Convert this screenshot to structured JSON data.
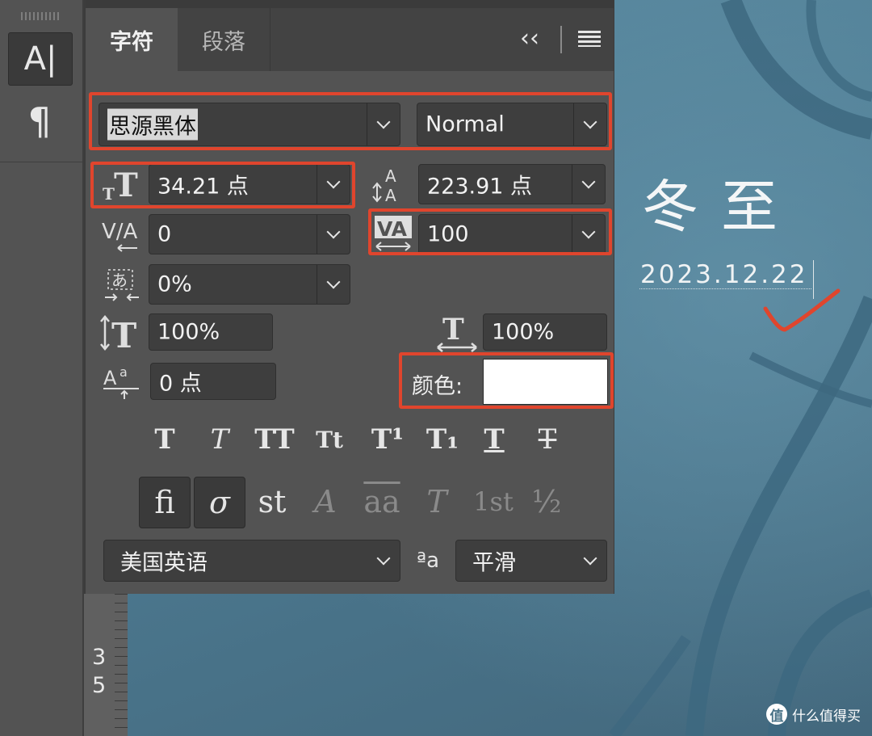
{
  "canvas": {
    "title": "冬至",
    "date": "2023.12.22",
    "watermark": "什么值得买",
    "watermark_icon": "值"
  },
  "toolbar": {
    "text_tool_icon": "A|",
    "paragraph_tool_icon": "¶"
  },
  "ruler": {
    "digits": [
      "3",
      "5"
    ]
  },
  "panel": {
    "tabs": [
      "字符",
      "段落"
    ],
    "collapse_icon": "‹‹",
    "menu_icon": "menu-icon",
    "font_family": "思源黑体",
    "font_style": "Normal",
    "font_size": "34.21 点",
    "leading": "223.91 点",
    "kerning": "0",
    "tracking": "100",
    "tsume": "0%",
    "vertical_scale": "100%",
    "horizontal_scale": "100%",
    "baseline_shift": "0 点",
    "color_label": "颜色:",
    "color_value": "#ffffff",
    "style_buttons": [
      "T",
      "T",
      "TT",
      "Tt",
      "T¹",
      "T₁",
      "T",
      "T"
    ],
    "opentype_buttons": [
      "ﬁ",
      "σ",
      "st",
      "A",
      "aa",
      "T",
      "1st",
      "½"
    ],
    "language": "美国英语",
    "antialias_icon": "ªa",
    "antialias": "平滑"
  },
  "annotation_color": "#e0452d"
}
